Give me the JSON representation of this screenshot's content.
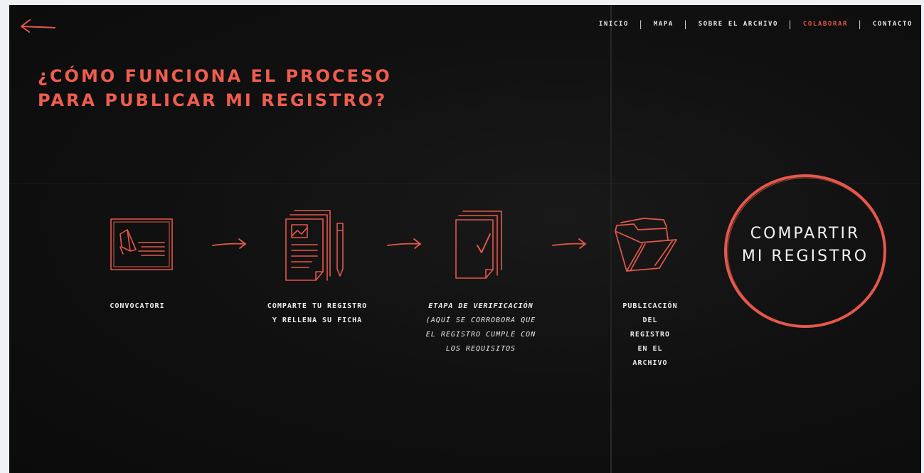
{
  "nav": {
    "items": [
      {
        "label": "INICIO"
      },
      {
        "label": "MAPA"
      },
      {
        "label": "SOBRE EL ARCHIVO"
      },
      {
        "label": "COLABORAR"
      },
      {
        "label": "CONTACTO"
      }
    ],
    "separator": "|",
    "active_color": "#e4584b"
  },
  "hero": {
    "title_line1": "¿CÓMO FUNCIONA EL PROCESO",
    "title_line2": "PARA PUBLICAR MI REGISTRO?",
    "accent_color": "#ef5d4f"
  },
  "steps": [
    {
      "icon": "megaphone-card-icon",
      "lines": [
        "CONVOCATORI"
      ]
    },
    {
      "icon": "document-pencil-icon",
      "lines": [
        "COMPARTE TU REGISTRO",
        "Y RELLENA SU FICHA"
      ]
    },
    {
      "icon": "checkmark-document-icon",
      "lines": [
        "ETAPA DE VERIFICACIÓN",
        "(AQUÍ SE CORROBORA QUE",
        "EL REGISTRO CUMPLE CON",
        "LOS REQUISITOS"
      ]
    },
    {
      "icon": "open-folder-icon",
      "lines": [
        "PUBLICACIÓN",
        "DEL",
        "REGISTRO",
        "EN EL",
        "ARCHIVO"
      ]
    }
  ],
  "cta": {
    "line1": "COMPARTIR",
    "line2": "MI REGISTRO",
    "ring_color": "#e4584b"
  }
}
